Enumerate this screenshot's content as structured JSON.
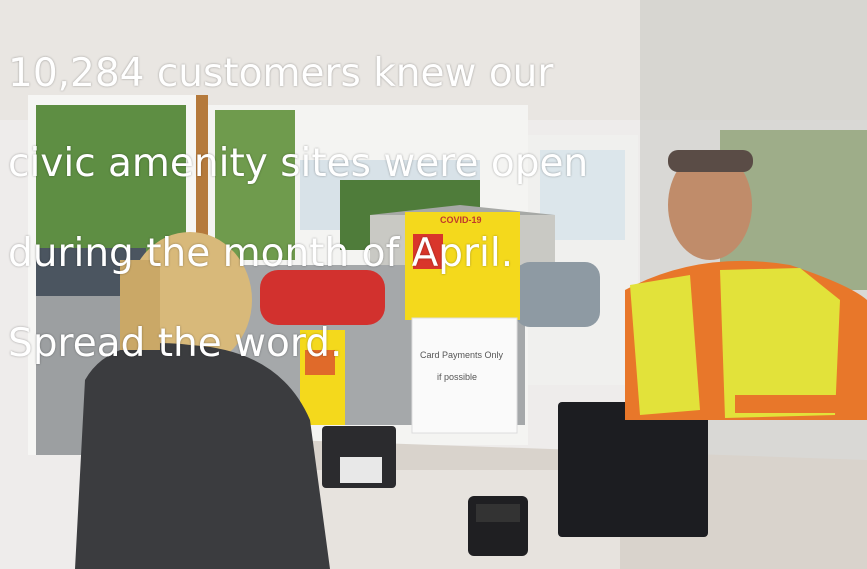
{
  "headline": {
    "line1": "10,284 customers knew our",
    "line2": "civic amenity sites were open",
    "line3": "during the month of April.",
    "line4": "Spread the word."
  },
  "poster": {
    "title": "COVID-19"
  },
  "notice": {
    "line1": "Card Payments Only",
    "line2": "if possible"
  },
  "colors": {
    "hi_vis_yellow": "#e2e23a",
    "poster_yellow": "#f4d91c",
    "orange": "#e8772a"
  }
}
